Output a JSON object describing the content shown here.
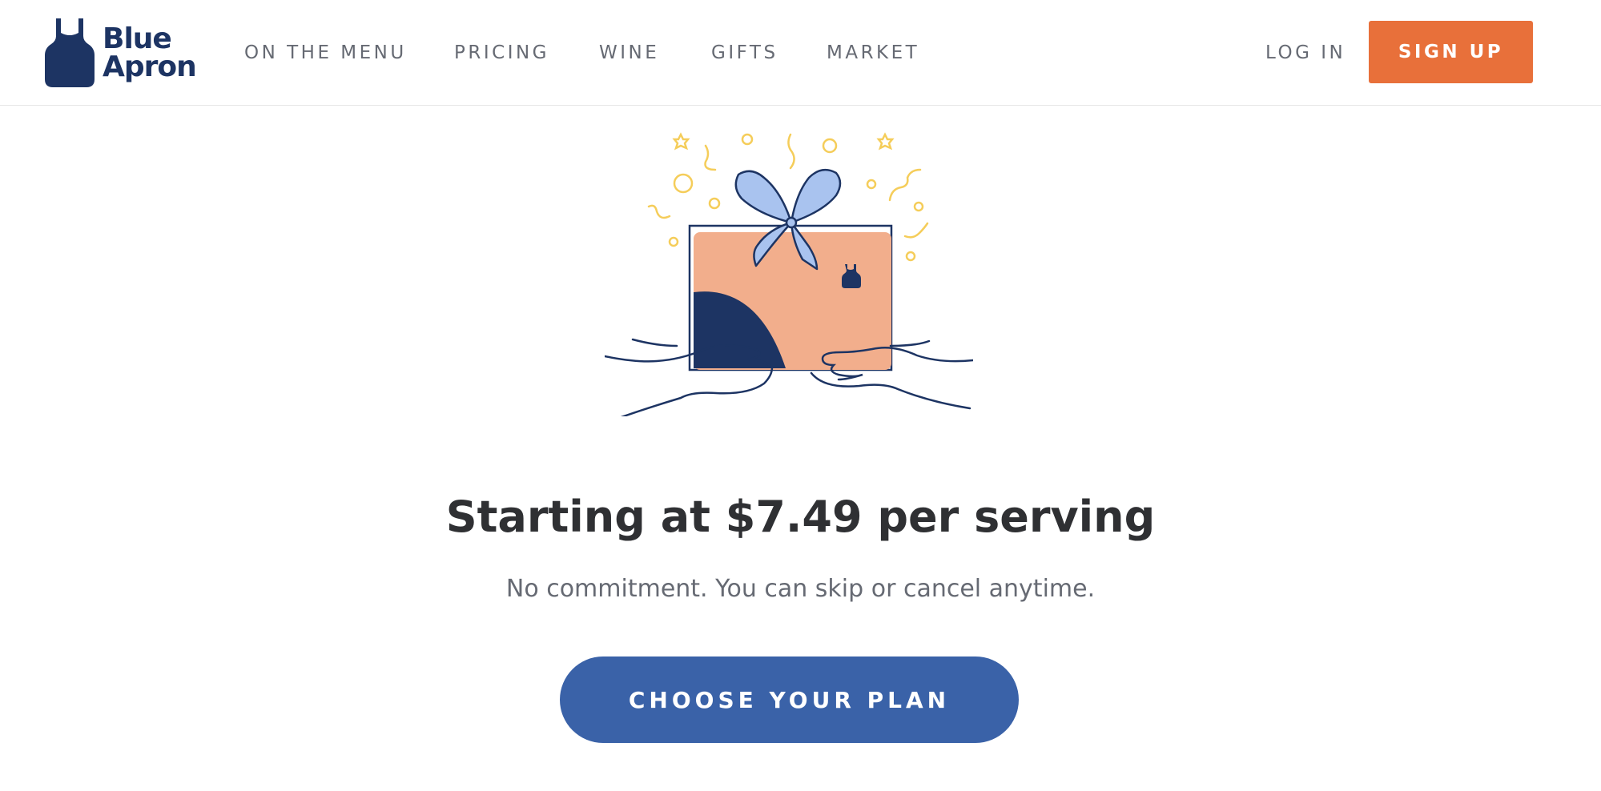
{
  "brand": {
    "name_line1": "Blue",
    "name_line2": "Apron"
  },
  "nav": {
    "items": [
      {
        "label": "ON THE MENU"
      },
      {
        "label": "PRICING"
      },
      {
        "label": "WINE"
      },
      {
        "label": "GIFTS"
      },
      {
        "label": "MARKET"
      }
    ],
    "login_label": "LOG IN",
    "signup_label": "SIGN UP"
  },
  "hero": {
    "headline": "Starting at $7.49 per serving",
    "subline": "No commitment. You can skip or cancel anytime.",
    "cta_label": "CHOOSE YOUR PLAN"
  },
  "colors": {
    "brand_navy": "#1d3463",
    "signup_orange": "#e8703a",
    "cta_blue": "#3a62a8",
    "gift_box_peach": "#f2ae8c",
    "ribbon_blue": "#a9c3ef",
    "confetti_yellow": "#f5cd5a"
  },
  "icons": {
    "logo": "apron-icon",
    "illustration": "gift-box-illustration"
  }
}
